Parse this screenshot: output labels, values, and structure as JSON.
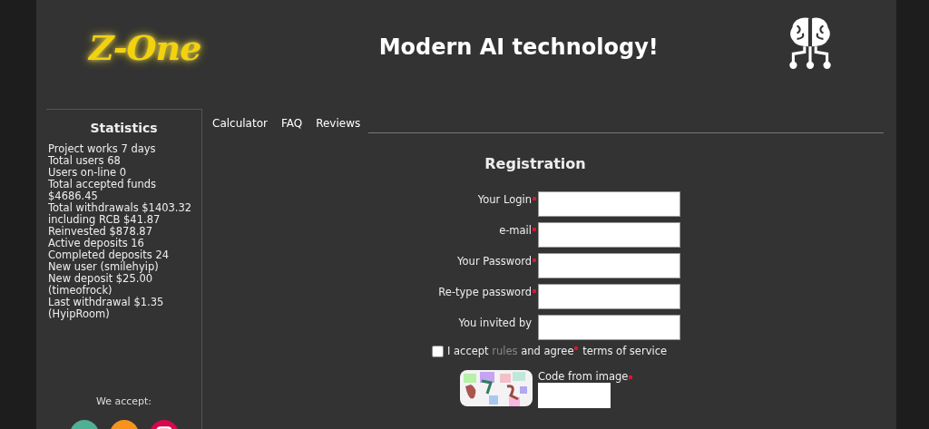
{
  "header": {
    "logo": "Z-One",
    "tagline": "Modern AI technology!"
  },
  "sidebar": {
    "title": "Statistics",
    "lines": [
      "Project works 7 days",
      "Total users 68",
      "Users on-line 0",
      "Total accepted funds $4686.45",
      "Total withdrawals $1403.32 including RCB $41.87",
      "Reinvested $878.87",
      "Active deposits 16",
      "Completed deposits 24",
      "New user (smilehyip)",
      "New deposit $25.00 (timeofrock)",
      "Last withdrawal $1.35 (HyipRoom)"
    ],
    "accept_label": "We accept:"
  },
  "nav": [
    "Calculator",
    "FAQ",
    "Reviews"
  ],
  "form": {
    "title": "Registration",
    "fields": [
      {
        "label": "Your Login",
        "required": true
      },
      {
        "label": "e-mail",
        "required": true
      },
      {
        "label": "Your Password",
        "required": true
      },
      {
        "label": "Re-type password",
        "required": true
      },
      {
        "label": "You invited by",
        "required": false
      }
    ],
    "agree": {
      "checked": false,
      "before": "I accept",
      "link": "rules",
      "middle": "and agree",
      "after": "terms of service"
    },
    "captcha": {
      "kind": "picture",
      "label": "Code from image",
      "required": true
    }
  }
}
